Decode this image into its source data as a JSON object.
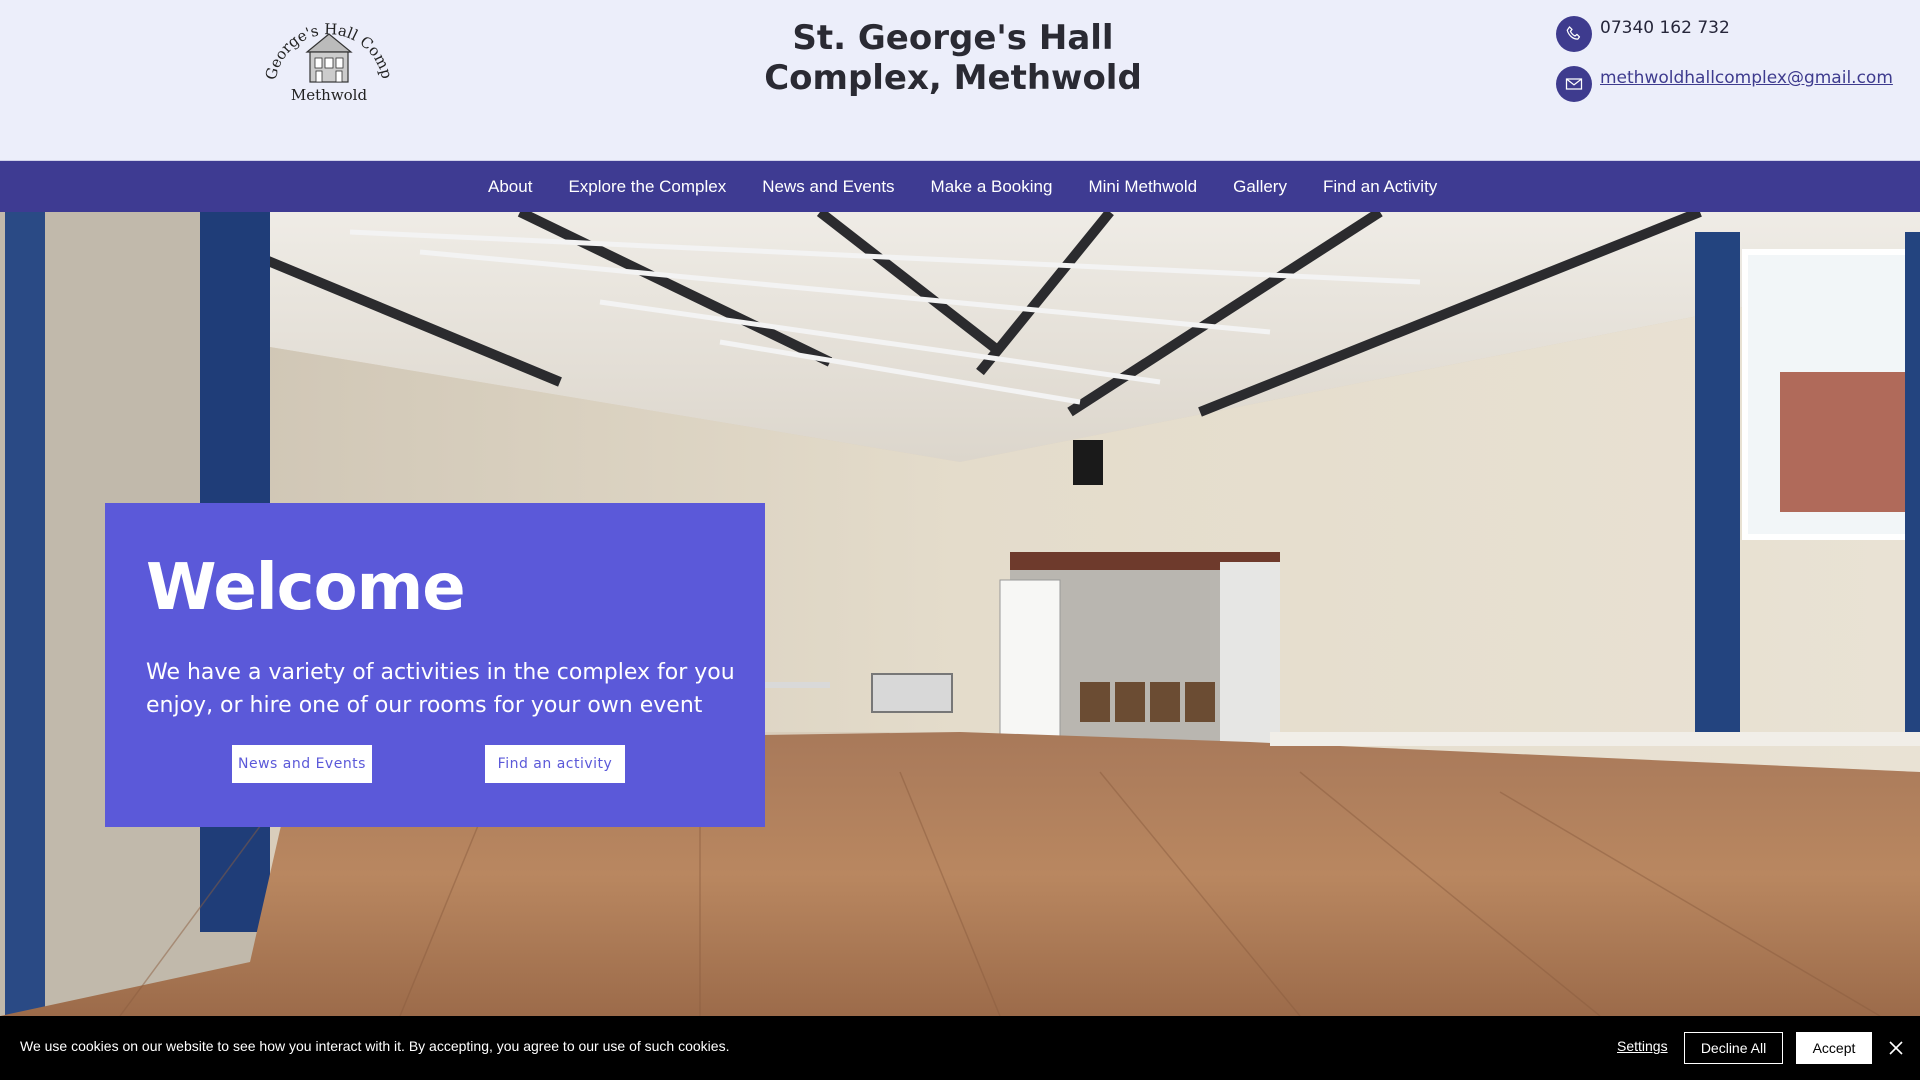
{
  "header": {
    "logo": {
      "arc_text": "St George's Hall Complex",
      "bottom_text": "Methwold"
    },
    "title": "St. George's Hall Complex, Methwold",
    "phone": "07340 162 732",
    "email": "methwoldhallcomplex@gmail.com",
    "icons": {
      "phone": "phone-icon",
      "email": "envelope-icon"
    }
  },
  "nav": {
    "items": [
      {
        "label": "About"
      },
      {
        "label": "Explore the Complex"
      },
      {
        "label": "News and Events"
      },
      {
        "label": "Make a Booking"
      },
      {
        "label": "Mini Methwold"
      },
      {
        "label": "Gallery"
      },
      {
        "label": "Find an Activity"
      }
    ]
  },
  "hero": {
    "title": "Welcome",
    "text": "We have a variety of activities in the complex for you enjoy, or hire one of our rooms for your own event",
    "buttons": {
      "news": "News and Events",
      "find": "Find an activity"
    }
  },
  "cookie": {
    "text": "We use cookies on our website to see how you interact with it. By accepting, you agree to our use of such cookies.",
    "settings": "Settings",
    "decline": "Decline All",
    "accept": "Accept",
    "close_icon": "close-icon"
  },
  "colors": {
    "header_bg": "#eceefa",
    "nav_bg": "#3e3b92",
    "welcome_bg": "#5b59d9",
    "cookie_bg": "#000000"
  }
}
